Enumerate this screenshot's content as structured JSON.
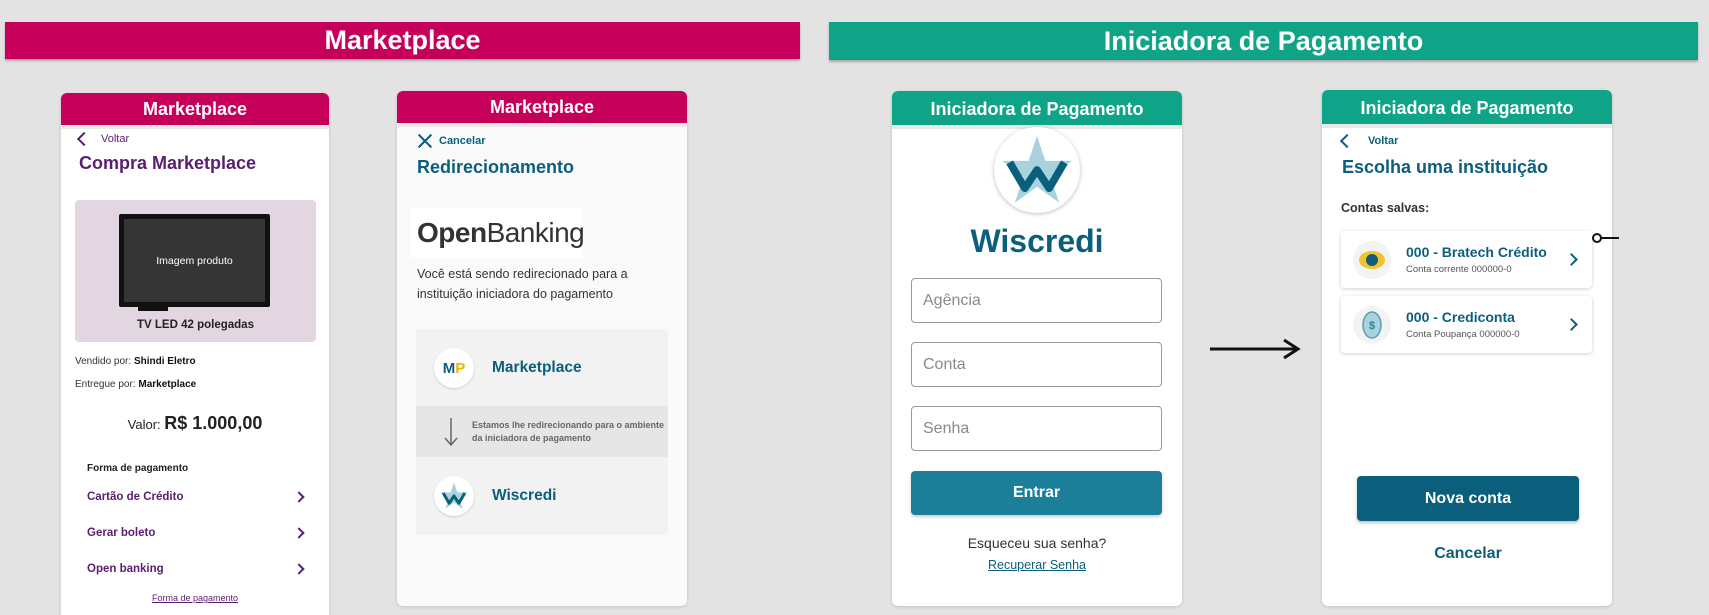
{
  "banners": {
    "marketplace": "Marketplace",
    "initiator": "Iniciadora de Pagamento"
  },
  "phone1": {
    "header": "Marketplace",
    "back_label": "Voltar",
    "title": "Compra Marketplace",
    "product_image_label": "Imagem produto",
    "product_name": "TV LED 42 polegadas",
    "sold_by_label": "Vendido por:",
    "sold_by_value": "Shindi Eletro",
    "delivered_by_label": "Entregue por:",
    "delivered_by_value": "Marketplace",
    "price_label": "Valor:",
    "price_value": "R$ 1.000,00",
    "payment_title": "Forma de pagamento",
    "payment_options": [
      "Cartão de Crédito",
      "Gerar boleto",
      "Open banking"
    ],
    "payment_link": "Forma de pagamento"
  },
  "phone2": {
    "header": "Marketplace",
    "cancel_label": "Cancelar",
    "title": "Redirecionamento",
    "logo_open": "Open",
    "logo_banking": "Banking",
    "message": "Você está sendo redirecionado para a instituição iniciadora do pagamento",
    "from_initials_1": "M",
    "from_initials_2": "P",
    "from_name": "Marketplace",
    "note": "Estamos lhe redirecionando para o ambiente da iniciadora de pagamento",
    "to_name": "Wiscredi"
  },
  "phone3": {
    "header": "Iniciadora de Pagamento",
    "brand": "Wiscredi",
    "agency_placeholder": "Agência",
    "account_placeholder": "Conta",
    "password_placeholder": "Senha",
    "enter_label": "Entrar",
    "forgot_text": "Esqueceu sua senha?",
    "recover_link": "Recuperar Senha"
  },
  "phone4": {
    "header": "Iniciadora de Pagamento",
    "back_label": "Voltar",
    "title": "Escolha uma instituição",
    "saved_label": "Contas salvas:",
    "accounts": [
      {
        "name": "000 - Bratech Crédito",
        "detail": "Conta corrente 000000-0"
      },
      {
        "name": "000 - Crediconta",
        "detail": "Conta Poupança 000000-0"
      }
    ],
    "new_account_label": "Nova conta",
    "cancel_label": "Cancelar"
  },
  "colors": {
    "magenta": "#c6005a",
    "teal": "#0fa487",
    "purple": "#5a1e6e",
    "dark_teal": "#0b5f7c"
  }
}
